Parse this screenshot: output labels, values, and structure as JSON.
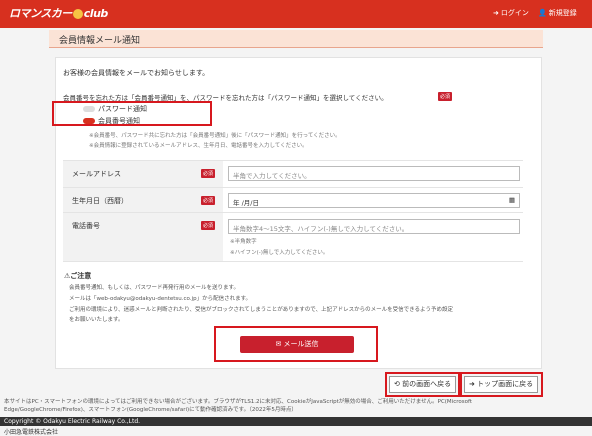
{
  "header": {
    "logo_text": "ロマンスカー",
    "logo_suffix": "club",
    "login": "ログイン",
    "register": "新規登録"
  },
  "title": "会員情報メール通知",
  "intro": "お客様の会員情報をメールでお知らせします。",
  "question": "会員番号を忘れた方は「会員番号通知」を、パスワードを忘れた方は「パスワード通知」を選択してください。",
  "required": "必須",
  "radios": [
    {
      "label": "パスワード通知",
      "checked": false
    },
    {
      "label": "会員番号通知",
      "checked": true
    }
  ],
  "notes": [
    "※会員番号、パスワード共に忘れた方は「会員番号通知」後に「パスワード通知」を行ってください。",
    "※会員情報に登録されているメールアドレス、生年月日、電話番号を入力してください。"
  ],
  "fields": {
    "email_label": "メールアドレス",
    "email_placeholder": "半角で入力してください。",
    "birth_label": "生年月日（西暦）",
    "birth_placeholder": "年 /月/日",
    "phone_label": "電話番号",
    "phone_placeholder": "半角数字4～15文字、ハイフン(-)無しで入力してください。",
    "phone_hint1": "※半角数字",
    "phone_hint2": "※ハイフン(-)無しで入力してください。"
  },
  "caution": {
    "title": "ご注意",
    "lines": [
      "会員番号通知、もしくは、パスワード再発行用のメールを送ります。",
      "メールは「web-odakyu@odakyu-dentetsu.co.jp」から配信されます。",
      "ご利用の環境により、迷惑メールと判断されたり、受信がブロックされてしまうことがありますので、上記アドレスからのメールを受信できるよう予め設定",
      "をお願いいたします。"
    ]
  },
  "send_button": "メール送信",
  "back_button": "前の画面へ戻る",
  "top_button": "トップ画面に戻る",
  "footer": {
    "note1": "本サイトはPC・スマートフォンの環境によってはご利用できない場合がございます。ブラウザがTLS1.2に未対応、CookieがJavaScriptが無効の場合、ご利用いただけません。PC(Microsoft",
    "note2": "Edge/GoogleChrome/Firefox)、スマートフォン(GoogleChrome/safari)にて動作確認済みです。（2022年5月時点）",
    "copyright": "Copyright © Odakyu Electric Railway Co.,Ltd.",
    "company": "小田急電鉄株式会社"
  }
}
